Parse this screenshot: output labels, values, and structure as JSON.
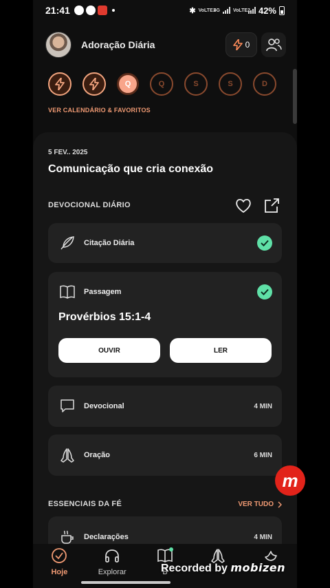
{
  "status_bar": {
    "time": "21:41",
    "battery": "42%",
    "net1": "VoLTE1",
    "net2": "VoLTE2",
    "net_type": "4G"
  },
  "header": {
    "app_title": "Adoração Diária",
    "streak_count": "0"
  },
  "week": {
    "days": [
      {
        "label": "",
        "state": "done"
      },
      {
        "label": "",
        "state": "done"
      },
      {
        "label": "Q",
        "state": "today"
      },
      {
        "label": "Q",
        "state": "future"
      },
      {
        "label": "S",
        "state": "future"
      },
      {
        "label": "S",
        "state": "future"
      },
      {
        "label": "D",
        "state": "future"
      }
    ],
    "calendar_link": "VER CALENDÁRIO & FAVORITOS"
  },
  "devotional": {
    "date": "5 FEV.. 2025",
    "title": "Comunicação que cria conexão",
    "section_title": "DEVOCIONAL DIÁRIO",
    "items": {
      "quote": {
        "label": "Citação Diária",
        "completed": true
      },
      "passage": {
        "label": "Passagem",
        "reference": "Provérbios 15:1-4",
        "listen_label": "OUVIR",
        "read_label": "LER",
        "completed": true
      },
      "devotional": {
        "label": "Devocional",
        "duration": "4 MIN"
      },
      "prayer": {
        "label": "Oração",
        "duration": "6 MIN"
      }
    }
  },
  "essentials": {
    "section_title": "ESSENCIAIS DA FÉ",
    "see_all": "VER TUDO",
    "items": [
      {
        "label": "Declarações",
        "duration": "4 MIN"
      }
    ]
  },
  "bottom_nav": {
    "items": [
      {
        "label": "Hoje",
        "active": true
      },
      {
        "label": "Explorar",
        "active": false
      },
      {
        "label": "B",
        "active": false
      },
      {
        "label": "",
        "active": false
      },
      {
        "label": "",
        "active": false
      }
    ]
  },
  "overlay": {
    "watermark_prefix": "Recorded by",
    "watermark_brand": "mobizen",
    "bubble": "m"
  },
  "colors": {
    "accent": "#f09a73",
    "success": "#5fe0a7",
    "card": "#222222",
    "background": "#0f0f0f"
  }
}
